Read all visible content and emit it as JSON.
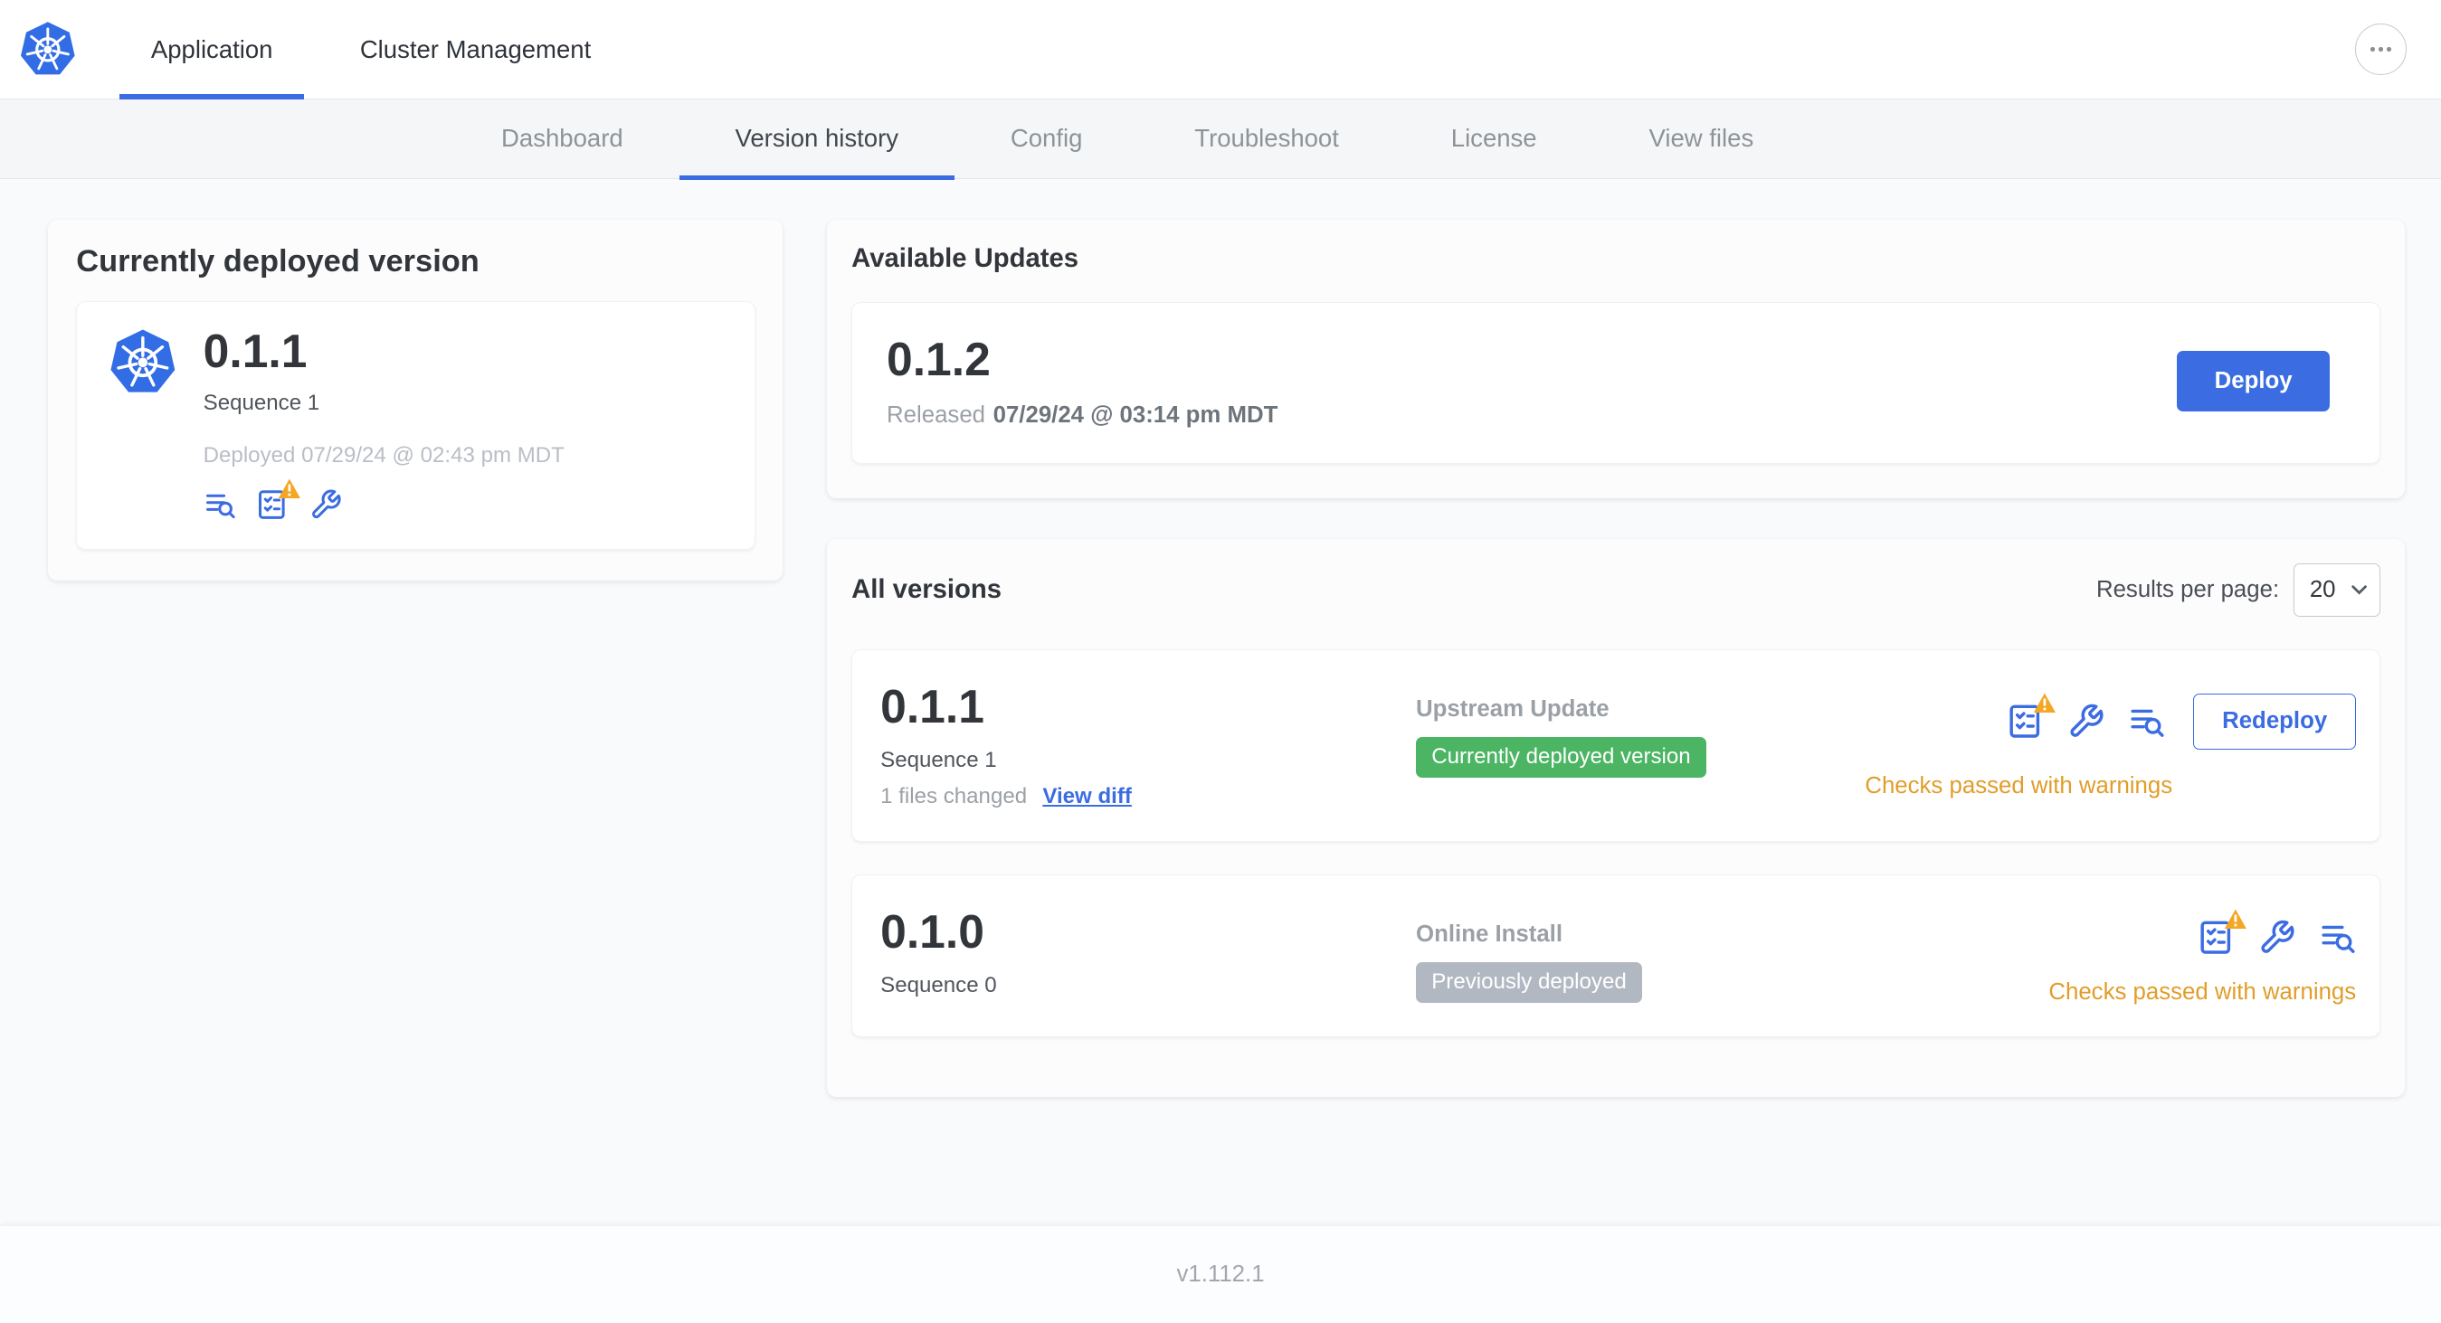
{
  "topnav": {
    "tabs": [
      {
        "label": "Application",
        "active": true
      },
      {
        "label": "Cluster Management",
        "active": false
      }
    ]
  },
  "subnav": {
    "tabs": [
      "Dashboard",
      "Version history",
      "Config",
      "Troubleshoot",
      "License",
      "View files"
    ],
    "active_tab": "Version history"
  },
  "current_version": {
    "title": "Currently deployed version",
    "version": "0.1.1",
    "sequence": "Sequence 1",
    "deployed": "Deployed 07/29/24 @ 02:43 pm MDT",
    "icons": [
      "logs-icon",
      "preflight-checks-warning-icon",
      "config-icon"
    ]
  },
  "available_updates": {
    "title": "Available Updates",
    "version": "0.1.2",
    "released_prefix": "Released",
    "released_date": "07/29/24 @ 03:14 pm MDT",
    "deploy_label": "Deploy"
  },
  "all_versions": {
    "title": "All versions",
    "results_per_page_label": "Results per page:",
    "results_per_page_value": "20",
    "rows": [
      {
        "version": "0.1.1",
        "sequence": "Sequence 1",
        "files_changed": "1 files changed",
        "view_diff_label": "View diff",
        "source": "Upstream Update",
        "badge": "Currently deployed version",
        "badge_color": "#4cb564",
        "icons": [
          "preflight-checks-warning-icon",
          "config-icon",
          "logs-icon"
        ],
        "action_label": "Redeploy",
        "status": "Checks passed with warnings",
        "status_color": "#e19d29"
      },
      {
        "version": "0.1.0",
        "sequence": "Sequence 0",
        "source": "Online Install",
        "badge": "Previously deployed",
        "badge_color": "#b2b8c2",
        "icons": [
          "preflight-checks-warning-icon",
          "config-icon",
          "logs-icon"
        ],
        "status": "Checks passed with warnings",
        "status_color": "#e19d29"
      }
    ]
  },
  "footer": {
    "version": "v1.112.1"
  },
  "colors": {
    "accent_blue": "#3b6ce2",
    "warning_orange": "#e19d29",
    "badge_green": "#4cb564",
    "badge_gray": "#b2b8c2"
  }
}
